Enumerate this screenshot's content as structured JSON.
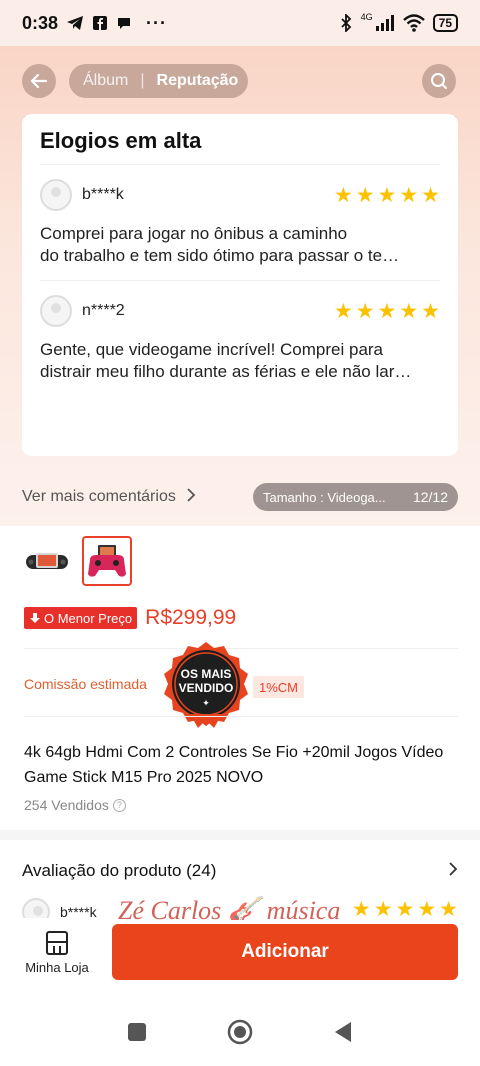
{
  "status_bar": {
    "time": "0:38",
    "battery": "75",
    "network": "4G"
  },
  "header": {
    "tabs": [
      {
        "label": "Álbum",
        "active": false
      },
      {
        "label": "Reputação",
        "active": true
      }
    ]
  },
  "highlights": {
    "title": "Elogios em alta",
    "reviews": [
      {
        "user": "b****k",
        "rating": 5,
        "line1": "Comprei para jogar no ônibus a caminho",
        "line2": "do trabalho e tem sido ótimo para passar o te…"
      },
      {
        "user": "n****2",
        "rating": 5,
        "line1": "Gente, que videogame incrível! Comprei para",
        "line2": "distrair meu filho durante as férias e ele não lar…"
      }
    ]
  },
  "more_comments": {
    "label": "Ver mais comentários",
    "variant_label": "Tamanho : Videoga...",
    "variant_count": "12/12"
  },
  "product": {
    "lowest_price_badge": "O Menor Preço",
    "price": "R$299,99",
    "commission_label": "Comissão estimada",
    "commission_badge": "1%CM",
    "best_seller_top": "OS MAIS",
    "best_seller_bottom": "VENDIDO",
    "title": "4k 64gb Hdmi Com 2 Controles Se Fio +20mil Jogos Vídeo Game Stick M15 Pro 2025 NOVO",
    "sold": "254 Vendidos"
  },
  "rating_section": {
    "title": "Avaliação do produto (24)",
    "partial_user": "b****k",
    "partial_rating": 5
  },
  "watermark": "Zé Carlos 🎸 música",
  "bottom_bar": {
    "shop_label": "Minha Loja",
    "add_label": "Adicionar"
  },
  "colors": {
    "accent": "#e9441b",
    "price": "#e8402a",
    "star": "#fcc200",
    "header_pill": "#c9a89c"
  },
  "icons": {
    "back": "back-arrow-icon",
    "search": "search-icon",
    "shop": "store-icon",
    "info": "info-icon"
  }
}
